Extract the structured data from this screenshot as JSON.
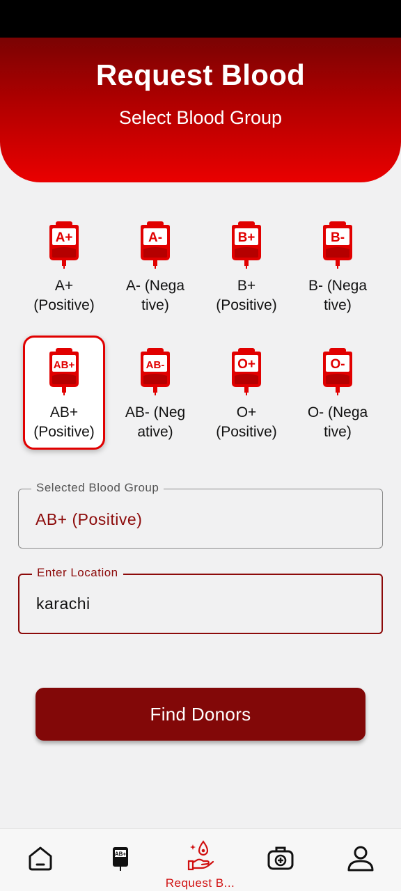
{
  "header": {
    "title": "Request Blood",
    "subtitle": "Select Blood Group"
  },
  "blood_groups": [
    {
      "badge": "A+",
      "label": "A+\n(Positive)",
      "selected": false
    },
    {
      "badge": "A-",
      "label": "A- (Nega\ntive)",
      "selected": false
    },
    {
      "badge": "B+",
      "label": "B+\n(Positive)",
      "selected": false
    },
    {
      "badge": "B-",
      "label": "B- (Nega\ntive)",
      "selected": false
    },
    {
      "badge": "AB+",
      "label": "AB+\n(Positive)",
      "selected": true
    },
    {
      "badge": "AB-",
      "label": "AB- (Neg\native)",
      "selected": false
    },
    {
      "badge": "O+",
      "label": "O+\n(Positive)",
      "selected": false
    },
    {
      "badge": "O-",
      "label": "O- (Nega\ntive)",
      "selected": false
    }
  ],
  "selected_field": {
    "legend": "Selected Blood Group",
    "value": "AB+ (Positive)"
  },
  "location_field": {
    "legend": "Enter Location",
    "value": "karachi"
  },
  "find_button": {
    "label": "Find Donors"
  },
  "bottom_nav": {
    "items": [
      {
        "icon": "home-icon",
        "label": ""
      },
      {
        "icon": "blood-bag-icon",
        "badge": "AB+",
        "label": ""
      },
      {
        "icon": "donate-blood-icon",
        "label": "Request B...",
        "active": true
      },
      {
        "icon": "medical-kit-icon",
        "label": ""
      },
      {
        "icon": "profile-icon",
        "label": ""
      }
    ]
  },
  "colors": {
    "primary_red": "#e10000",
    "dark_red": "#820808",
    "background": "#f1f1f2"
  }
}
